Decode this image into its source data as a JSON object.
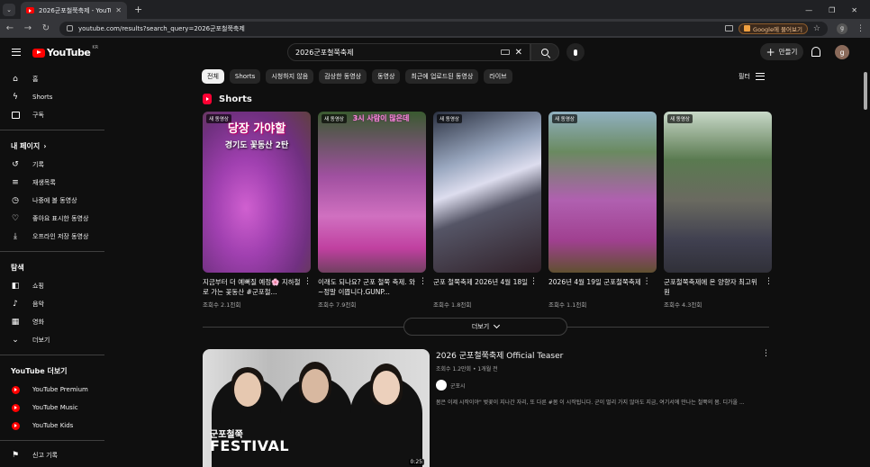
{
  "browser": {
    "tab_title": "2026군포철쭉축제 - YouTube",
    "url": "youtube.com/results?search_query=2026군포철쭉축제",
    "google_button": "Google에 물어보기",
    "profile_initial": "g"
  },
  "masthead": {
    "logo_text": "YouTube",
    "logo_region": "KR",
    "search_value": "2026군포철쭉축제",
    "create_label": "만들기",
    "avatar_initial": "g"
  },
  "sidebar": {
    "main": [
      {
        "label": "홈",
        "icon": "home-icon"
      },
      {
        "label": "Shorts",
        "icon": "shorts-icon"
      },
      {
        "label": "구독",
        "icon": "subscriptions-icon"
      }
    ],
    "my_page_header": "내 페이지",
    "my_page": [
      {
        "label": "기록",
        "icon": "history-icon"
      },
      {
        "label": "재생목록",
        "icon": "playlist-icon"
      },
      {
        "label": "나중에 볼 동영상",
        "icon": "watch-later-icon"
      },
      {
        "label": "좋아요 표시한 동영상",
        "icon": "like-icon"
      },
      {
        "label": "오프라인 저장 동영상",
        "icon": "download-icon"
      }
    ],
    "explore_header": "탐색",
    "explore": [
      {
        "label": "쇼핑",
        "icon": "shopping-icon"
      },
      {
        "label": "음악",
        "icon": "music-icon"
      },
      {
        "label": "영화",
        "icon": "movie-icon"
      },
      {
        "label": "더보기",
        "icon": "chevron-down-icon"
      }
    ],
    "more_yt_header": "YouTube 더보기",
    "more_yt": [
      {
        "label": "YouTube Premium",
        "icon": "youtube-premium-icon"
      },
      {
        "label": "YouTube Music",
        "icon": "youtube-music-icon"
      },
      {
        "label": "YouTube Kids",
        "icon": "youtube-kids-icon"
      }
    ],
    "report_label": "신고 기록"
  },
  "chips": [
    "전체",
    "Shorts",
    "시청하지 않음",
    "감상한 동영상",
    "동영상",
    "최근에 업로드된 동영상",
    "라이브"
  ],
  "filter_label": "필터",
  "shorts_header": "Shorts",
  "shorts": [
    {
      "badge": "새 동영상",
      "overlay1": "당장 가야할",
      "overlay2": "경기도 꽃동산 2탄",
      "title": "지금부터 더 예뻐질 예정🌸 지하철로 가는 꽃동산 #군포철...",
      "views": "조회수 2.1천회"
    },
    {
      "badge": "새 동영상",
      "overlay1": "3시 사람이 많은데",
      "overlay2": "",
      "title": "이래도 되나요? 군포 철쭉 축제. 와~정말 이쁩니다.GUNP...",
      "views": "조회수 7.9천회"
    },
    {
      "badge": "새 동영상",
      "overlay1": "",
      "overlay2": "",
      "title": "군포 철쭉축제 2026년 4월 18일",
      "views": "조회수 1.8천회"
    },
    {
      "badge": "새 동영상",
      "overlay1": "",
      "overlay2": "",
      "title": "2026년 4월 19일 군포철쭉축제",
      "views": "조회수 1.1천회"
    },
    {
      "badge": "새 동영상",
      "overlay1": "",
      "overlay2": "",
      "title": "군포철쭉축제에 온 양향자 최고위원",
      "views": "조회수 4.3천회"
    }
  ],
  "more_button": "더보기",
  "video": {
    "title": "2026 군포철쭉축제 Official Teaser",
    "meta": "조회수 1.2만회 • 1개월 전",
    "channel": "군포시",
    "description": "봄은 이제 시작이야\" 벚꽃이 지나간 자리, 또 다른 #봄 이 시작됩니다. 군이 멀리 가지 않아도 지금, 여기서에 만나는 철쭉의 봄. 디가올 ...",
    "thumb_text_small": "군포철쭉",
    "thumb_text_big": "FESTIVAL",
    "duration": "0:25"
  }
}
